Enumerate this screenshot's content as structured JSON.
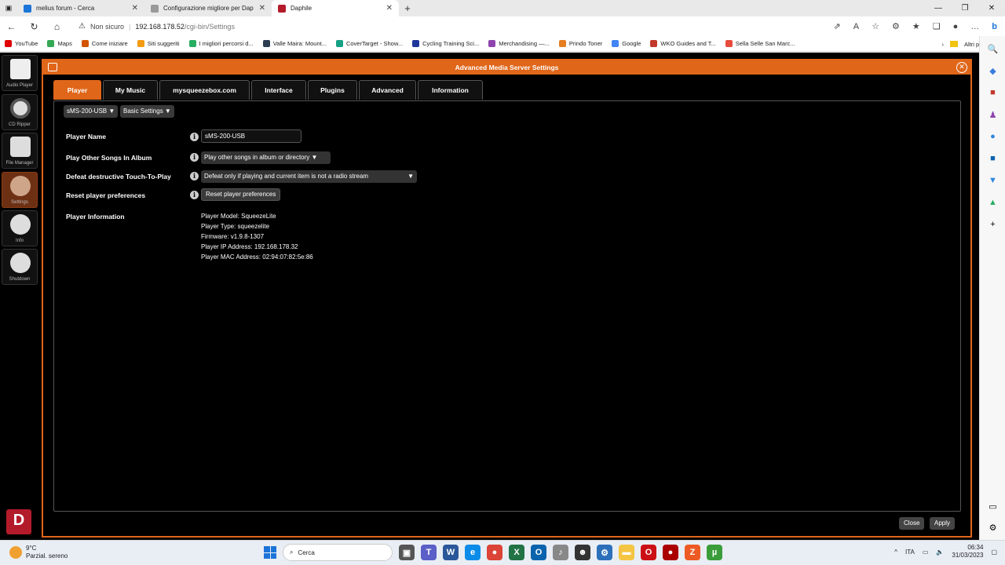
{
  "browser": {
    "tabs": [
      {
        "title": "melius forum - Cerca",
        "color": "#1b74d8",
        "active": false
      },
      {
        "title": "Configurazione migliore per Dap",
        "color": "#999999",
        "active": false
      },
      {
        "title": "Daphile",
        "color": "#b31b2a",
        "active": true
      }
    ],
    "window_controls": {
      "minimize": "—",
      "restore": "❐",
      "close": "✕"
    },
    "address": {
      "security_label": "Non sicuro",
      "url_host": "192.168.178.52",
      "url_path": "/cgi-bin/Settings"
    },
    "bookmarks": [
      {
        "label": "YouTube",
        "color": "#e00000"
      },
      {
        "label": "Maps",
        "color": "#34a853"
      },
      {
        "label": "Come iniziare",
        "color": "#d35400"
      },
      {
        "label": "Siti suggeriti",
        "color": "#f39c12"
      },
      {
        "label": "I migliori percorsi d...",
        "color": "#27ae60"
      },
      {
        "label": "Valle Maira: Mount...",
        "color": "#2c3e50"
      },
      {
        "label": "CoverTarget - Show...",
        "color": "#16a085"
      },
      {
        "label": "Cycling Training Sci...",
        "color": "#1e3799"
      },
      {
        "label": "Merchandising —...",
        "color": "#8e44ad"
      },
      {
        "label": "Prindo Toner",
        "color": "#e67e22"
      },
      {
        "label": "Google",
        "color": "#4285f4"
      },
      {
        "label": "WKO Guides and T...",
        "color": "#c0392b"
      },
      {
        "label": "Sella Selle San Marc...",
        "color": "#e74c3c"
      }
    ],
    "other_favorites": "Altri preferiti"
  },
  "sidebar": {
    "items": [
      {
        "label": "Audio Player",
        "icon": "music-note-icon"
      },
      {
        "label": "CD Ripper",
        "icon": "cd-icon"
      },
      {
        "label": "File Manager",
        "icon": "box-icon"
      },
      {
        "label": "Settings",
        "icon": "gear-icon"
      },
      {
        "label": "Info",
        "icon": "info-icon"
      },
      {
        "label": "Shutdown",
        "icon": "power-icon"
      }
    ],
    "logo_letter": "D"
  },
  "dialog": {
    "title": "Advanced Media Server Settings",
    "tabs": [
      "Player",
      "My Music",
      "mysqueezebox.com",
      "Interface",
      "Plugins",
      "Advanced",
      "Information"
    ],
    "active_tab": "Player",
    "player_select": "sMS-200-USB ▼",
    "settings_select": "Basic Settings ▼",
    "fields": {
      "player_name_label": "Player Name",
      "player_name_value": "sMS-200-USB",
      "play_other_label": "Play Other Songs In Album",
      "play_other_value": "Play other songs in album or directory ▼",
      "defeat_label": "Defeat destructive Touch-To-Play",
      "defeat_value": "Defeat only if playing and current item is not a radio stream",
      "defeat_arrow": "▼",
      "reset_label": "Reset player preferences",
      "reset_button": "Reset player preferences",
      "info_label": "Player Information"
    },
    "player_info": [
      "Player Model: SqueezeLite",
      "Player Type: squeezelite",
      "Firmware: v1.9.8-1307",
      "Player IP Address: 192.168.178.32",
      "Player MAC Address: 02:94:07:82:5e:86"
    ],
    "close_button": "Close",
    "apply_button": "Apply"
  },
  "taskbar": {
    "temperature": "9°C",
    "weather": "Parzial. sereno",
    "search_placeholder": "Cerca",
    "language": "ITA",
    "time": "06:34",
    "date": "31/03/2023"
  }
}
